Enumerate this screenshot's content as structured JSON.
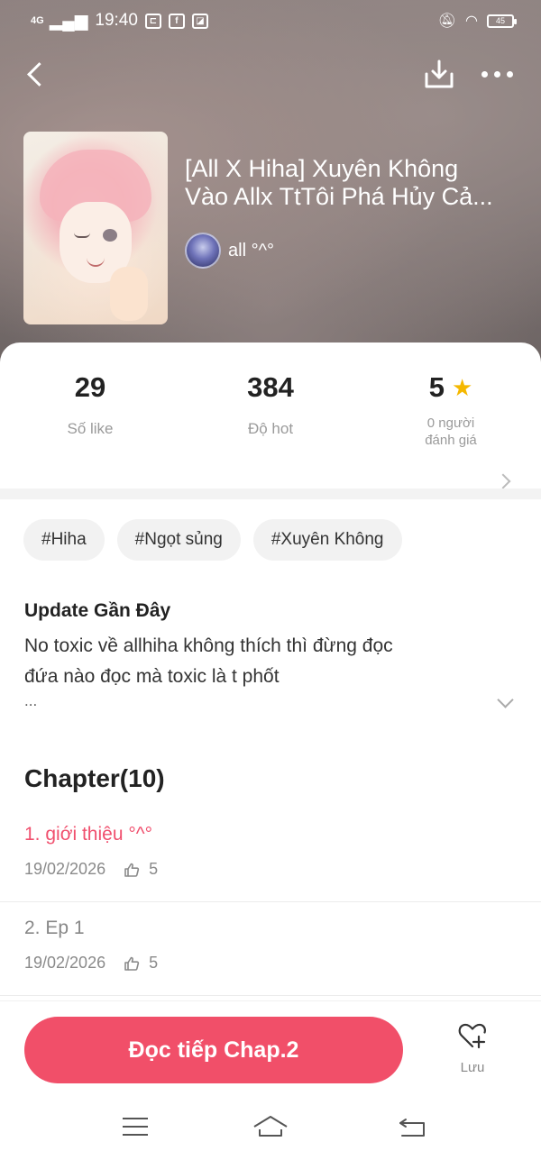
{
  "status_bar": {
    "signal": "4G",
    "time": "19:40",
    "battery": "45"
  },
  "story": {
    "title_line1": "[All X Hiha] Xuyên Không",
    "title_line2": "Vào Allx TtTôi Phá Hủy Cả...",
    "author": "all °^°"
  },
  "stats": {
    "likes_value": "29",
    "likes_label": "Số like",
    "hot_value": "384",
    "hot_label": "Độ hot",
    "rating_value": "5",
    "rating_label_line1": "0 người",
    "rating_label_line2": "đánh giá"
  },
  "tags": [
    "#Hiha",
    "#Ngọt sủng",
    "#Xuyên Không"
  ],
  "update": {
    "title": "Update Gần Đây",
    "line1": "No toxic về allhiha không thích thì đừng đọc",
    "line2": "đứa nào đọc mà toxic là t phốt",
    "more": "..."
  },
  "chapters": {
    "heading": "Chapter(10)",
    "items": [
      {
        "title": "1. giới thiệu °^°",
        "date": "19/02/2026",
        "likes": "5"
      },
      {
        "title": "2. Ep 1",
        "date": "19/02/2026",
        "likes": "5"
      }
    ]
  },
  "actions": {
    "read_label": "Đọc tiếp Chap.2",
    "save_label": "Lưu"
  },
  "colors": {
    "accent": "#f14f69",
    "active_chapter": "#f0506e",
    "star": "#f5b800"
  }
}
